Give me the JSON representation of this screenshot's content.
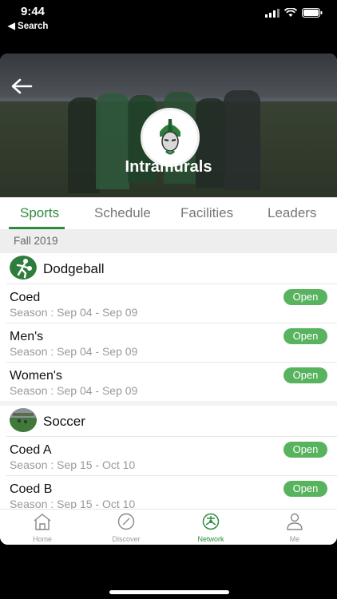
{
  "status_bar": {
    "time": "9:44",
    "back_label": "◀ Search"
  },
  "header": {
    "title": "Intramurals"
  },
  "tabs": [
    {
      "label": "Sports"
    },
    {
      "label": "Schedule"
    },
    {
      "label": "Facilities"
    },
    {
      "label": "Leaders"
    }
  ],
  "season_label": "Fall 2019",
  "sports": [
    {
      "name": "Dodgeball",
      "icon": "dodgeball-icon",
      "leagues": [
        {
          "name": "Coed",
          "season": "Season : Sep 04 - Sep 09",
          "status": "Open"
        },
        {
          "name": "Men's",
          "season": "Season : Sep 04 - Sep 09",
          "status": "Open"
        },
        {
          "name": "Women's",
          "season": "Season : Sep 04 - Sep 09",
          "status": "Open"
        }
      ]
    },
    {
      "name": "Soccer",
      "icon": "soccer-field-icon",
      "leagues": [
        {
          "name": "Coed A",
          "season": "Season : Sep 15 - Oct 10",
          "status": "Open"
        },
        {
          "name": "Coed B",
          "season": "Season : Sep 15 - Oct 10",
          "status": "Open"
        }
      ]
    }
  ],
  "tab_bar": [
    {
      "label": "Home",
      "icon": "home-icon"
    },
    {
      "label": "Discover",
      "icon": "compass-icon"
    },
    {
      "label": "Network",
      "icon": "network-icon"
    },
    {
      "label": "Me",
      "icon": "person-icon"
    }
  ],
  "colors": {
    "accent": "#2e8b3e",
    "badge": "#58b35f"
  }
}
